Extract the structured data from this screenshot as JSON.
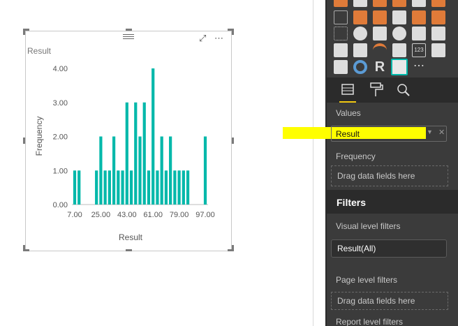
{
  "visual": {
    "title": "Result",
    "more_options": "⋯",
    "focus_mode": "⤢"
  },
  "chart_data": {
    "type": "bar",
    "title": "Result",
    "xlabel": "Result",
    "ylabel": "Frequency",
    "ylim": [
      0,
      4
    ],
    "y_ticks": [
      "0.00",
      "1.00",
      "2.00",
      "3.00",
      "4.00"
    ],
    "x_ticks": [
      "7.00",
      "25.00",
      "43.00",
      "61.00",
      "79.00",
      "97.00"
    ],
    "grid": false,
    "bar_color": "#01b8aa",
    "x": [
      7,
      10,
      13,
      16,
      19,
      22,
      25,
      28,
      31,
      34,
      37,
      40,
      43,
      46,
      49,
      52,
      55,
      58,
      61,
      64,
      67,
      70,
      73,
      76,
      79,
      82,
      85,
      88,
      91,
      94,
      97
    ],
    "values": [
      1,
      1,
      0,
      0,
      0,
      1,
      2,
      1,
      1,
      2,
      1,
      1,
      3,
      1,
      3,
      2,
      3,
      1,
      4,
      1,
      2,
      1,
      2,
      1,
      1,
      1,
      1,
      0,
      0,
      0,
      2
    ]
  },
  "fields_pane": {
    "values_label": "Values",
    "values_field": "Result",
    "frequency_label": "Frequency",
    "frequency_placeholder": "Drag data fields here",
    "filters_header": "Filters",
    "visual_filters_label": "Visual level filters",
    "visual_filter_chip": "Result(All)",
    "page_filters_label": "Page level filters",
    "page_filters_placeholder": "Drag data fields here",
    "report_filters_label": "Report level filters",
    "gallery_text_r": "R",
    "gallery_text_123": "123",
    "gallery_more": "⋯"
  },
  "colors": {
    "accent_teal": "#01b8aa",
    "accent_orange": "#e07b39",
    "highlight_yellow": "#ffff00",
    "panel_bg": "#3b3b3b",
    "active_tab": "#f2c811"
  }
}
